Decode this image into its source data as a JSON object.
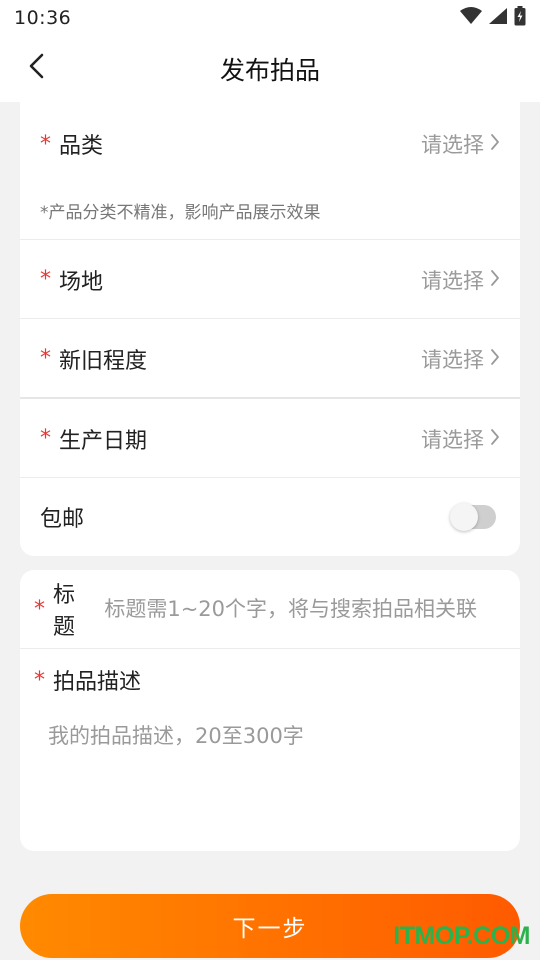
{
  "status_bar": {
    "time": "10:36"
  },
  "nav": {
    "title": "发布拍品"
  },
  "form": {
    "category": {
      "required": "*",
      "label": "品类",
      "value": "请选择"
    },
    "category_hint": "*产品分类不精准，影响产品展示效果",
    "venue": {
      "required": "*",
      "label": "场地",
      "value": "请选择"
    },
    "condition": {
      "required": "*",
      "label": "新旧程度",
      "value": "请选择"
    },
    "production_date": {
      "required": "*",
      "label": "生产日期",
      "value": "请选择"
    },
    "free_shipping": {
      "label": "包邮",
      "enabled": false
    }
  },
  "details": {
    "title": {
      "required": "*",
      "label": "标题",
      "placeholder": "标题需1~20个字，将与搜索拍品相关联"
    },
    "description": {
      "required": "*",
      "label": "拍品描述",
      "placeholder": "我的拍品描述，20至300字"
    }
  },
  "actions": {
    "next_label": "下一步"
  },
  "watermark": "ITMOP.COM",
  "colors": {
    "accent": "#ff7a00",
    "required": "#e53935",
    "watermark": "#2bb24c"
  }
}
